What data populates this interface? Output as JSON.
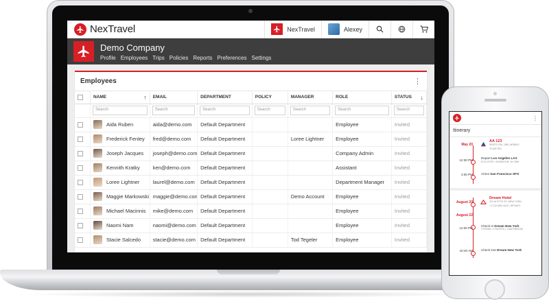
{
  "app": {
    "brand": "NexTravel",
    "accent": "#d71f26",
    "dark_bar": "#3e3e3e"
  },
  "topbar": {
    "company_chip": "NexTravel",
    "user_name": "Alexey",
    "icons": [
      "search-icon",
      "globe-icon",
      "cart-icon"
    ]
  },
  "company": {
    "name": "Demo Company",
    "nav": [
      "Profile",
      "Employees",
      "Trips",
      "Policies",
      "Reports",
      "Preferences",
      "Settings"
    ]
  },
  "employees": {
    "title": "Employees",
    "columns": [
      "NAME",
      "EMAIL",
      "DEPARTMENT",
      "POLICY",
      "MANAGER",
      "ROLE",
      "STATUS"
    ],
    "search_placeholder": "Search",
    "rows": [
      {
        "name": "Aida Ruben",
        "email": "aida@demo.com",
        "department": "Default Department",
        "policy": "",
        "manager": "",
        "role": "Employee",
        "status": "Invited"
      },
      {
        "name": "Frederick Fenley",
        "email": "fred@demo.com",
        "department": "Default Department",
        "policy": "",
        "manager": "Loree Lightner",
        "role": "Employee",
        "status": "Invited"
      },
      {
        "name": "Joseph Jacques",
        "email": "joseph@demo.com",
        "department": "Default Department",
        "policy": "",
        "manager": "",
        "role": "Company Admin",
        "status": "Invited"
      },
      {
        "name": "Kennith Kratky",
        "email": "ken@demo.com",
        "department": "Default Department",
        "policy": "",
        "manager": "",
        "role": "Assistant",
        "status": "Invited"
      },
      {
        "name": "Loree Lightner",
        "email": "laurel@demo.com",
        "department": "Default Department",
        "policy": "",
        "manager": "",
        "role": "Department Manager",
        "status": "Invited"
      },
      {
        "name": "Maggie Markowski",
        "email": "maggie@demo.com",
        "department": "Default Department",
        "policy": "",
        "manager": "Demo Account",
        "role": "Employee",
        "status": "Invited"
      },
      {
        "name": "Michael Macinnis",
        "email": "mike@demo.com",
        "department": "Default Department",
        "policy": "",
        "manager": "",
        "role": "Employee",
        "status": "Invited"
      },
      {
        "name": "Naomi Nam",
        "email": "naomi@demo.com",
        "department": "Default Department",
        "policy": "",
        "manager": "",
        "role": "Employee",
        "status": "Invited"
      },
      {
        "name": "Stacie Salcedo",
        "email": "stacie@demo.com",
        "department": "Default Department",
        "policy": "",
        "manager": "Tod Tegeler",
        "role": "Employee",
        "status": "Invited"
      }
    ]
  },
  "phone": {
    "title": "Itinerary",
    "flight": {
      "date": "May 20",
      "flight_no": "AA 123",
      "flight_detail": "SEATS 23A, 24B | MOBILE",
      "flight_detail2": "TICKETED",
      "time1": "12:30 PM",
      "depart_prefix": "Depart",
      "depart_city": "Los Angeles LAX",
      "depart_detail": "ECO-STOP • DURATION: 1H 25M",
      "time2": "4:00 PM",
      "arrive_prefix": "Arrive",
      "arrive_city": "San Francisco SFO"
    },
    "hotel": {
      "date1": "August 20",
      "hotel_name": "Dream Hotel",
      "hotel_detail": "210 W 57TH ST, NEW YORK",
      "hotel_detail2": "+1 212-555-0123 • DETAILS",
      "date2": "August 22",
      "time1": "12:00 PM",
      "checkin_prefix": "Check In",
      "checkin_place": "Dream New York",
      "checkin_detail": "1 ROOM • 2 NIGHTS • 1 BATHROOM",
      "time2": "10:40 AM",
      "checkout_prefix": "Check Out",
      "checkout_place": "Dream New York"
    }
  }
}
